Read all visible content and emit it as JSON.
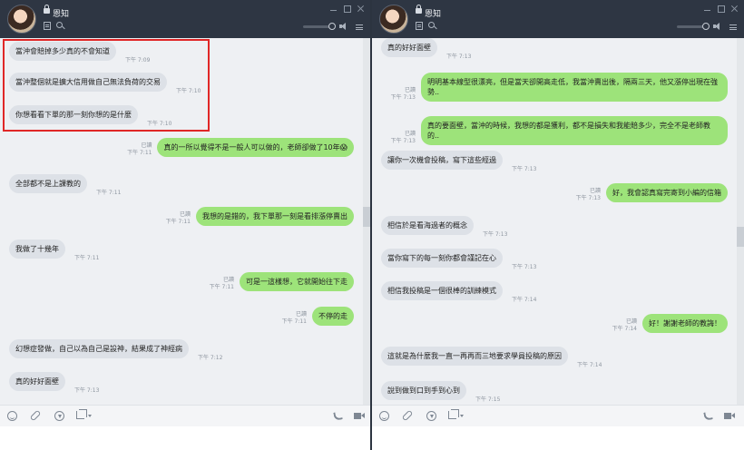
{
  "contact_name": "恩知",
  "left": {
    "messages": [
      {
        "dir": "in",
        "text": "當沖會賠掉多少真的不會知道",
        "time": "下午 7:09"
      },
      {
        "dir": "in",
        "text": "當沖整個就是擴大信用做自己無法負荷的交易",
        "time": "下午 7:10"
      },
      {
        "dir": "in",
        "text": "你想看看下單的那一刻你想的是什麼",
        "time": "下午 7:10"
      },
      {
        "dir": "out",
        "read": "已讀",
        "text": "真的一所以覺得不是一般人可以做的，老師卻做了10年😱",
        "time": "下午 7:11"
      },
      {
        "dir": "in",
        "text": "全部都不是上課教的",
        "time": "下午 7:11"
      },
      {
        "dir": "out",
        "read": "已讀",
        "text": "我想的是錯的，我下單那一刻是看排漲停賣出",
        "time": "下午 7:11"
      },
      {
        "dir": "in",
        "text": "我做了十幾年",
        "time": "下午 7:11"
      },
      {
        "dir": "out",
        "read": "已讀",
        "text": "可是一這樣想，它就開始往下走",
        "time": "下午 7:11"
      },
      {
        "dir": "out",
        "read": "已讀",
        "text": "不停的走",
        "time": "下午 7:11"
      },
      {
        "dir": "in",
        "text": "幻想症發做，自己以為自己是設神，結果成了神經病",
        "time": "下午 7:12"
      },
      {
        "dir": "in",
        "text": "真的好好面壁",
        "time": "下午 7:13"
      }
    ]
  },
  "right": {
    "messages": [
      {
        "dir": "in",
        "text": "真的好好面壁",
        "time": "下午 7:13"
      },
      {
        "dir": "out",
        "read": "已讀",
        "text": "明明基本線型很漂亮，但是當天卻開高走低，我當沖賣出後，隔兩三天，他又漲停出現在強勢..",
        "time": "下午 7:13"
      },
      {
        "dir": "out",
        "read": "已讀",
        "text": "真的要面壁，當沖的時候，我想的都是獲利，都不是損失和我能賠多少，完全不是老師教的..",
        "time": "下午 7:13"
      },
      {
        "dir": "in",
        "text": "讓你一次機會投稿，寫下這些經過",
        "time": "下午 7:13"
      },
      {
        "dir": "out",
        "read": "已讀",
        "text": "好，我會認真寫完寄到小編的信箱",
        "time": "下午 7:13"
      },
      {
        "dir": "in",
        "text": "相信於是看海過者的概念",
        "time": "下午 7:13"
      },
      {
        "dir": "in",
        "text": "當你寫下的每一刻你都會謹記在心",
        "time": "下午 7:13"
      },
      {
        "dir": "in",
        "text": "相信我投稿是一個很棒的訓練模式",
        "time": "下午 7:14"
      },
      {
        "dir": "out",
        "read": "已讀",
        "text": "好！謝謝老師的教誨！",
        "time": "下午 7:14"
      },
      {
        "dir": "in",
        "text": "這就是為什麼我一直一再再而三地要求學員投稿的原因",
        "time": "下午 7:14"
      },
      {
        "dir": "in",
        "text": "說到做到口到手到心到",
        "time": "下午 7:15"
      }
    ]
  },
  "icons": {
    "lock": "lock-icon",
    "note": "note-icon",
    "search": "search-icon",
    "emoji": "emoji-icon",
    "attach": "clip-icon",
    "download": "download-icon",
    "crop": "crop-icon",
    "call": "phone-icon",
    "video": "video-icon"
  },
  "colors": {
    "header_bg": "#2e3643",
    "incoming_bubble": "#dde1e7",
    "outgoing_bubble": "#9de37a",
    "highlight": "#e02727"
  }
}
